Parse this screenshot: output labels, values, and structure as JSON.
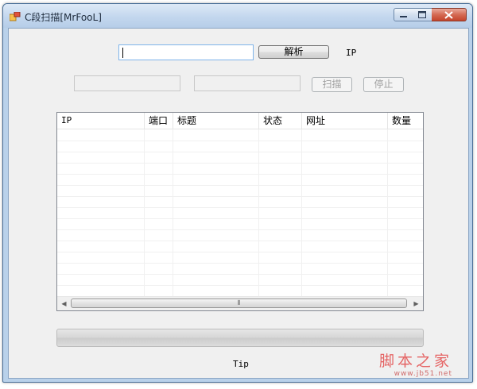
{
  "window": {
    "title": "C段扫描[MrFooL]",
    "close_color": "#c4452c"
  },
  "icons": {
    "app": "app-icon",
    "minimize": "minimize-icon",
    "maximize": "maximize-icon",
    "close": "close-icon"
  },
  "toolbar": {
    "target_input": {
      "value": "",
      "placeholder": ""
    },
    "parse_button": "解析",
    "ip_label": "IP",
    "start_ip_input": {
      "value": ""
    },
    "end_ip_input": {
      "value": ""
    },
    "scan_button": "扫描",
    "stop_button": "停止"
  },
  "results": {
    "columns": [
      "IP",
      "端口",
      "标题",
      "状态",
      "网址",
      "数量"
    ],
    "rows": [],
    "scroll_thumb_grip": "⦀"
  },
  "progress": {
    "value": 0
  },
  "status": {
    "tip": "Tip"
  },
  "watermark": {
    "text": "脚本之家",
    "url": "www.jb51.net"
  }
}
